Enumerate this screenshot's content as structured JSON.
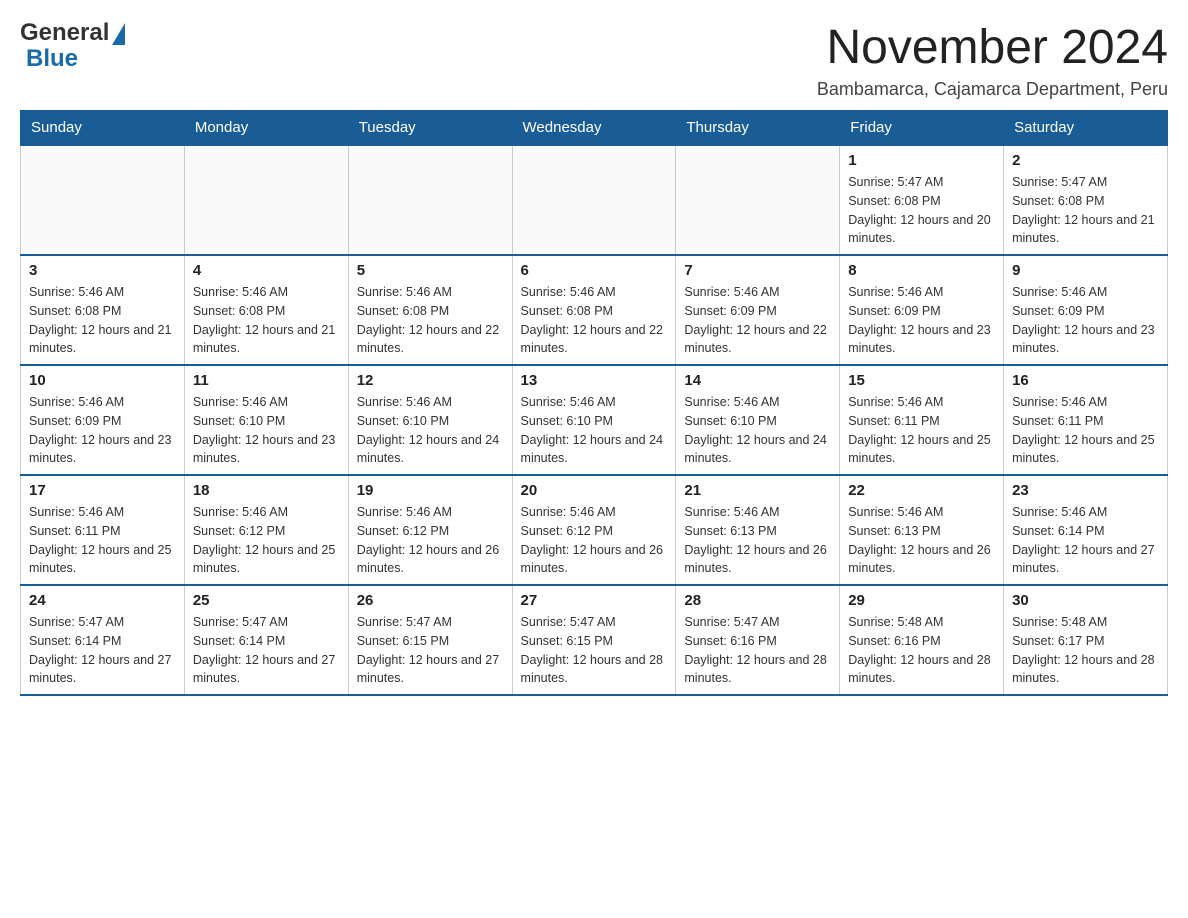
{
  "header": {
    "title": "November 2024",
    "subtitle": "Bambamarca, Cajamarca Department, Peru",
    "logo": {
      "general": "General",
      "blue": "Blue"
    }
  },
  "days_of_week": [
    "Sunday",
    "Monday",
    "Tuesday",
    "Wednesday",
    "Thursday",
    "Friday",
    "Saturday"
  ],
  "weeks": [
    {
      "cells": [
        {
          "day": "",
          "info": ""
        },
        {
          "day": "",
          "info": ""
        },
        {
          "day": "",
          "info": ""
        },
        {
          "day": "",
          "info": ""
        },
        {
          "day": "",
          "info": ""
        },
        {
          "day": "1",
          "info": "Sunrise: 5:47 AM\nSunset: 6:08 PM\nDaylight: 12 hours and 20 minutes."
        },
        {
          "day": "2",
          "info": "Sunrise: 5:47 AM\nSunset: 6:08 PM\nDaylight: 12 hours and 21 minutes."
        }
      ]
    },
    {
      "cells": [
        {
          "day": "3",
          "info": "Sunrise: 5:46 AM\nSunset: 6:08 PM\nDaylight: 12 hours and 21 minutes."
        },
        {
          "day": "4",
          "info": "Sunrise: 5:46 AM\nSunset: 6:08 PM\nDaylight: 12 hours and 21 minutes."
        },
        {
          "day": "5",
          "info": "Sunrise: 5:46 AM\nSunset: 6:08 PM\nDaylight: 12 hours and 22 minutes."
        },
        {
          "day": "6",
          "info": "Sunrise: 5:46 AM\nSunset: 6:08 PM\nDaylight: 12 hours and 22 minutes."
        },
        {
          "day": "7",
          "info": "Sunrise: 5:46 AM\nSunset: 6:09 PM\nDaylight: 12 hours and 22 minutes."
        },
        {
          "day": "8",
          "info": "Sunrise: 5:46 AM\nSunset: 6:09 PM\nDaylight: 12 hours and 23 minutes."
        },
        {
          "day": "9",
          "info": "Sunrise: 5:46 AM\nSunset: 6:09 PM\nDaylight: 12 hours and 23 minutes."
        }
      ]
    },
    {
      "cells": [
        {
          "day": "10",
          "info": "Sunrise: 5:46 AM\nSunset: 6:09 PM\nDaylight: 12 hours and 23 minutes."
        },
        {
          "day": "11",
          "info": "Sunrise: 5:46 AM\nSunset: 6:10 PM\nDaylight: 12 hours and 23 minutes."
        },
        {
          "day": "12",
          "info": "Sunrise: 5:46 AM\nSunset: 6:10 PM\nDaylight: 12 hours and 24 minutes."
        },
        {
          "day": "13",
          "info": "Sunrise: 5:46 AM\nSunset: 6:10 PM\nDaylight: 12 hours and 24 minutes."
        },
        {
          "day": "14",
          "info": "Sunrise: 5:46 AM\nSunset: 6:10 PM\nDaylight: 12 hours and 24 minutes."
        },
        {
          "day": "15",
          "info": "Sunrise: 5:46 AM\nSunset: 6:11 PM\nDaylight: 12 hours and 25 minutes."
        },
        {
          "day": "16",
          "info": "Sunrise: 5:46 AM\nSunset: 6:11 PM\nDaylight: 12 hours and 25 minutes."
        }
      ]
    },
    {
      "cells": [
        {
          "day": "17",
          "info": "Sunrise: 5:46 AM\nSunset: 6:11 PM\nDaylight: 12 hours and 25 minutes."
        },
        {
          "day": "18",
          "info": "Sunrise: 5:46 AM\nSunset: 6:12 PM\nDaylight: 12 hours and 25 minutes."
        },
        {
          "day": "19",
          "info": "Sunrise: 5:46 AM\nSunset: 6:12 PM\nDaylight: 12 hours and 26 minutes."
        },
        {
          "day": "20",
          "info": "Sunrise: 5:46 AM\nSunset: 6:12 PM\nDaylight: 12 hours and 26 minutes."
        },
        {
          "day": "21",
          "info": "Sunrise: 5:46 AM\nSunset: 6:13 PM\nDaylight: 12 hours and 26 minutes."
        },
        {
          "day": "22",
          "info": "Sunrise: 5:46 AM\nSunset: 6:13 PM\nDaylight: 12 hours and 26 minutes."
        },
        {
          "day": "23",
          "info": "Sunrise: 5:46 AM\nSunset: 6:14 PM\nDaylight: 12 hours and 27 minutes."
        }
      ]
    },
    {
      "cells": [
        {
          "day": "24",
          "info": "Sunrise: 5:47 AM\nSunset: 6:14 PM\nDaylight: 12 hours and 27 minutes."
        },
        {
          "day": "25",
          "info": "Sunrise: 5:47 AM\nSunset: 6:14 PM\nDaylight: 12 hours and 27 minutes."
        },
        {
          "day": "26",
          "info": "Sunrise: 5:47 AM\nSunset: 6:15 PM\nDaylight: 12 hours and 27 minutes."
        },
        {
          "day": "27",
          "info": "Sunrise: 5:47 AM\nSunset: 6:15 PM\nDaylight: 12 hours and 28 minutes."
        },
        {
          "day": "28",
          "info": "Sunrise: 5:47 AM\nSunset: 6:16 PM\nDaylight: 12 hours and 28 minutes."
        },
        {
          "day": "29",
          "info": "Sunrise: 5:48 AM\nSunset: 6:16 PM\nDaylight: 12 hours and 28 minutes."
        },
        {
          "day": "30",
          "info": "Sunrise: 5:48 AM\nSunset: 6:17 PM\nDaylight: 12 hours and 28 minutes."
        }
      ]
    }
  ]
}
